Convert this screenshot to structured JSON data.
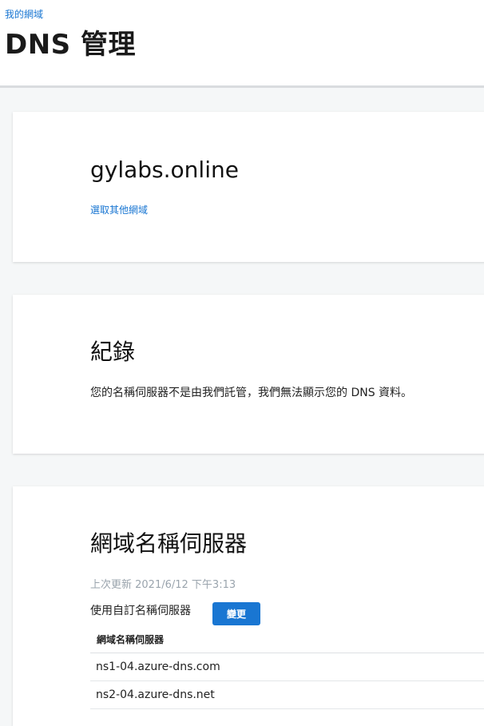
{
  "header": {
    "breadcrumb": "我的網域",
    "title": "DNS 管理"
  },
  "domain_card": {
    "domain": "gylabs.online",
    "select_other_link": "選取其他網域"
  },
  "records_card": {
    "title": "紀錄",
    "message": "您的名稱伺服器不是由我們託管，我們無法顯示您的 DNS 資料。"
  },
  "nameservers_card": {
    "title": "網域名稱伺服器",
    "last_updated": "上次更新 2021/6/12 下午3:13",
    "custom_label": "使用自訂名稱伺服器",
    "change_button": "變更",
    "table_header": "網域名稱伺服器",
    "rows": [
      "ns1-04.azure-dns.com",
      "ns2-04.azure-dns.net"
    ]
  },
  "colors": {
    "accent": "#1976d2",
    "muted_text": "#9aa4ad",
    "background": "#f5f7f8"
  }
}
